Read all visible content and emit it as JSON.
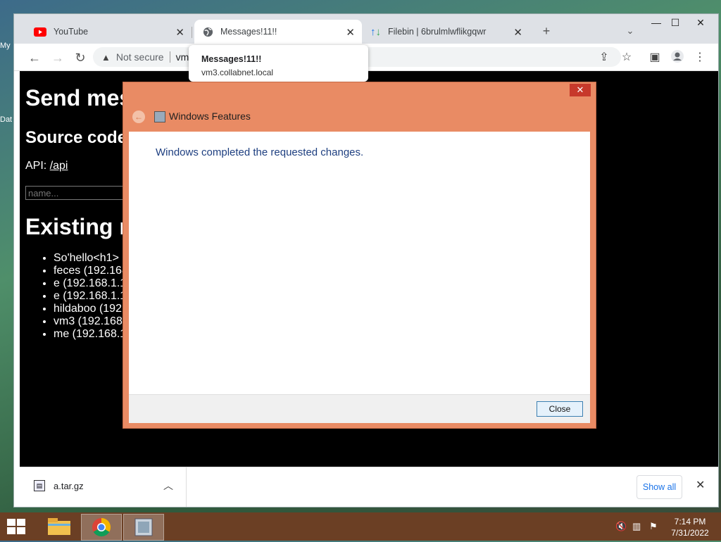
{
  "desktop": {
    "icon_label_1": "My",
    "icon_label_2": "Dat"
  },
  "browser": {
    "tabs": [
      {
        "title": "YouTube",
        "active": false
      },
      {
        "title": "Messages!11!!",
        "active": true
      },
      {
        "title": "Filebin | 6brulmlwflikgqwr",
        "active": false
      }
    ],
    "address": {
      "security_label": "Not secure",
      "url_fragment": "vm"
    },
    "tooltip": {
      "title": "Messages!11!!",
      "host": "vm3.collabnet.local"
    }
  },
  "page": {
    "heading": "Send mes",
    "source_heading": "Source code",
    "api_label": "API: ",
    "api_link": "/api",
    "name_placeholder": "name...",
    "existing_heading": "Existing r",
    "messages": [
      "So'hello<h1> (",
      "feces (192.168",
      "e (192.168.1.1",
      "e (192.168.1.1",
      "hildaboo (192.",
      "vm3 (192.168.",
      "me (192.168.1"
    ]
  },
  "downloads": {
    "file_name": "a.tar.gz",
    "show_all": "Show all"
  },
  "dialog": {
    "title": "Windows Features",
    "message": "Windows completed the requested changes.",
    "close_button": "Close"
  },
  "taskbar": {
    "time": "7:14 PM",
    "date": "7/31/2022"
  },
  "colors": {
    "dialog_frame": "#e98b64",
    "taskbar": "#6b3f24",
    "link_blue": "#1a73e8"
  }
}
